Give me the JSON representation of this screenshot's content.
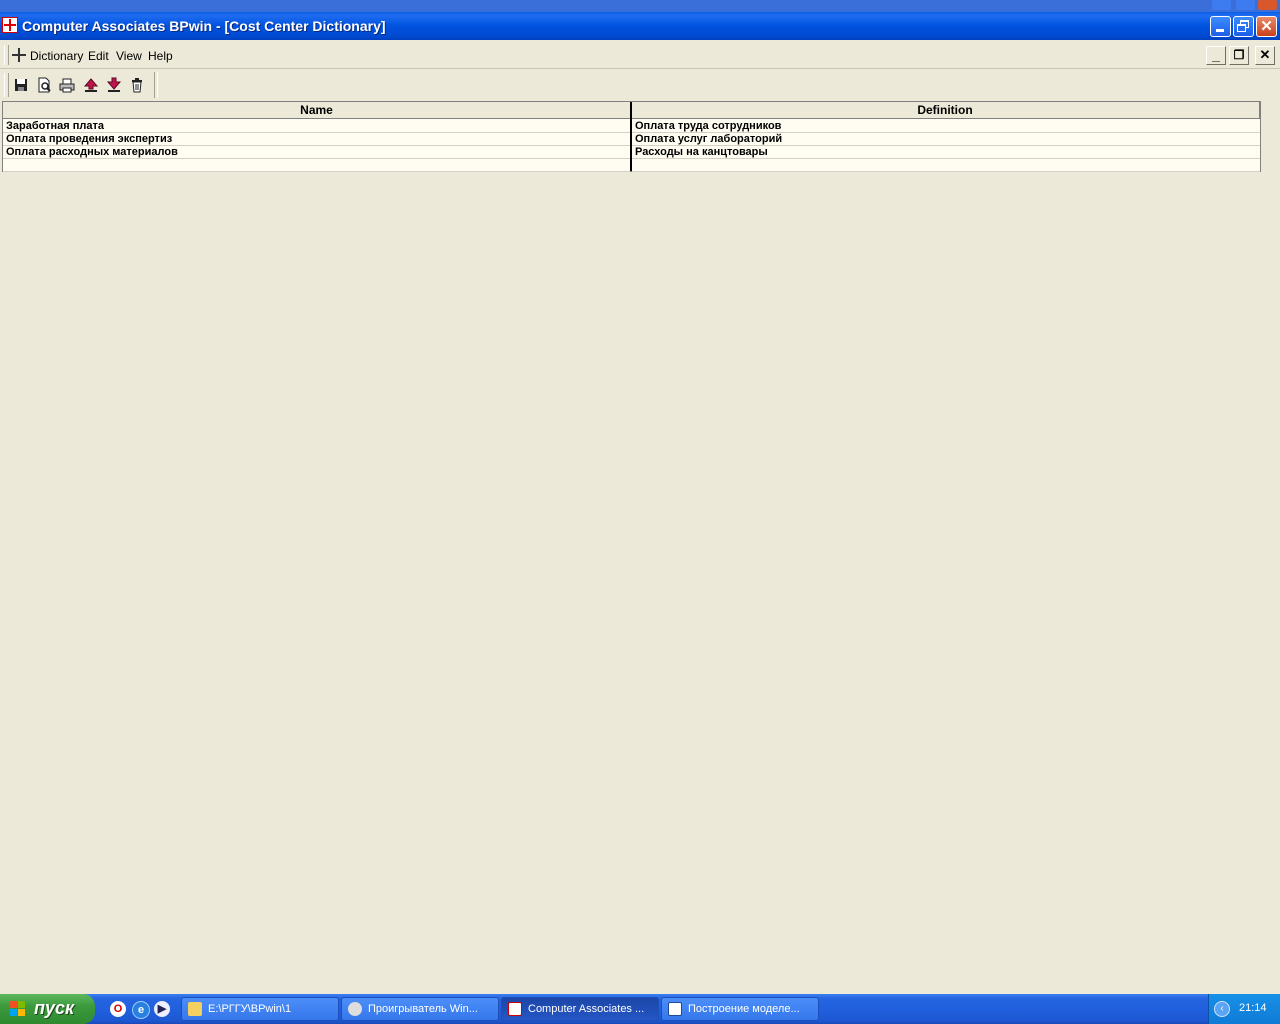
{
  "window": {
    "title": "Computer Associates BPwin - [Cost Center Dictionary]"
  },
  "menubar": {
    "items": [
      {
        "label": "Dictionary"
      },
      {
        "label": "Edit"
      },
      {
        "label": "View"
      },
      {
        "label": "Help"
      }
    ],
    "mdi_minimize": "_",
    "mdi_restore": "❐",
    "mdi_close": "✕"
  },
  "toolbar": {
    "buttons": [
      {
        "icon": "save-icon"
      },
      {
        "icon": "print-preview-icon"
      },
      {
        "icon": "print-icon"
      },
      {
        "icon": "move-up-icon"
      },
      {
        "icon": "move-down-icon"
      },
      {
        "icon": "delete-icon"
      }
    ]
  },
  "grid": {
    "columns": [
      "Name",
      "Definition"
    ],
    "rows": [
      {
        "name": "Заработная плата",
        "definition": "Оплата труда сотрудников"
      },
      {
        "name": "Оплата проведения экспертиз",
        "definition": "Оплата услуг лабораторий"
      },
      {
        "name": "Оплата расходных материалов",
        "definition": "Расходы на канцтовары"
      },
      {
        "name": "",
        "definition": ""
      }
    ]
  },
  "taskbar": {
    "start_label": "пуск",
    "tasks": [
      {
        "label": "E:\\РГГУ\\BPwin\\1",
        "icon": "folder-icon"
      },
      {
        "label": "Проигрыватель Win...",
        "icon": "media-player-icon"
      },
      {
        "label": "Computer Associates ...",
        "icon": "bpwin-icon"
      },
      {
        "label": "Построение моделе...",
        "icon": "word-icon"
      }
    ],
    "clock": "21:14"
  }
}
